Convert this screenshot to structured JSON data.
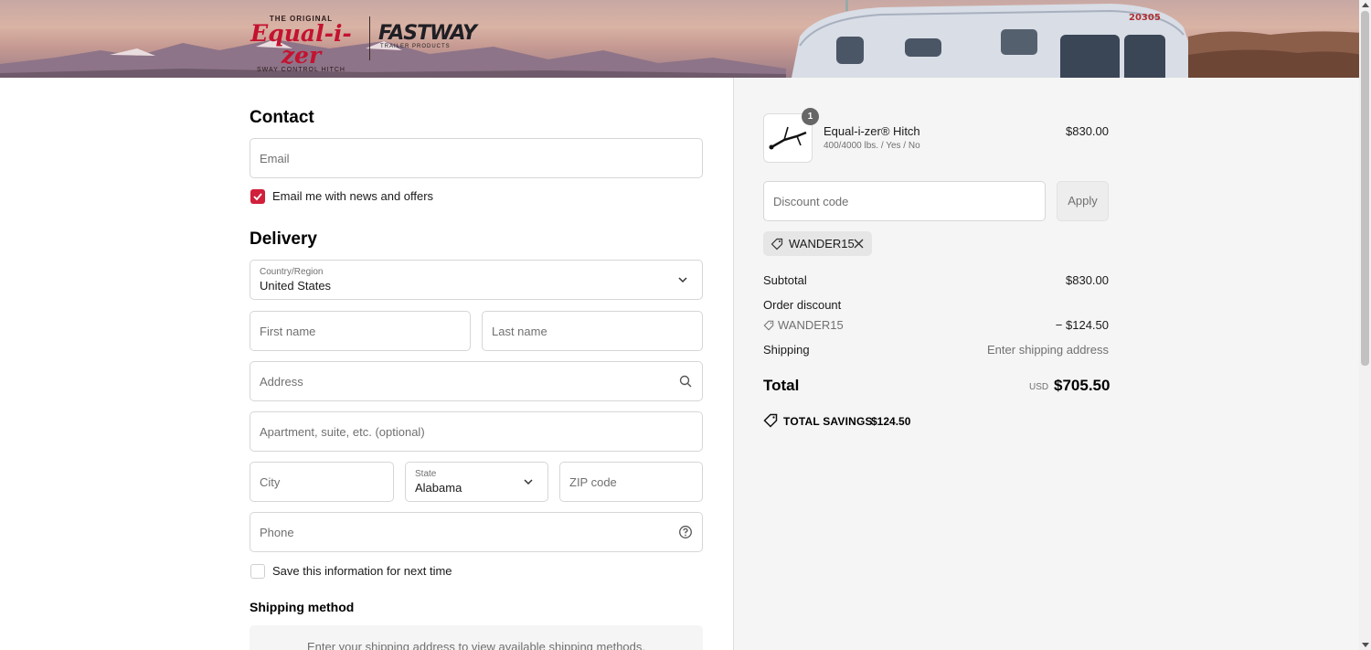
{
  "header": {
    "logo_equalizer_top": "THE ORIGINAL",
    "logo_equalizer_main": "Equal-i-zer",
    "logo_equalizer_bottom": "SWAY CONTROL HITCH",
    "logo_fastway_main": "FASTWAY",
    "logo_fastway_sub": "TRAILER PRODUCTS",
    "trailer_number": "20305"
  },
  "contact": {
    "heading": "Contact",
    "email_placeholder": "Email",
    "newsletter_label": "Email me with news and offers",
    "newsletter_checked": true
  },
  "delivery": {
    "heading": "Delivery",
    "country_label": "Country/Region",
    "country_value": "United States",
    "first_name_placeholder": "First name",
    "last_name_placeholder": "Last name",
    "address_placeholder": "Address",
    "apartment_placeholder": "Apartment, suite, etc. (optional)",
    "city_placeholder": "City",
    "state_label": "State",
    "state_value": "Alabama",
    "zip_placeholder": "ZIP code",
    "phone_placeholder": "Phone",
    "save_info_label": "Save this information for next time",
    "save_info_checked": false
  },
  "shipping_method": {
    "heading": "Shipping method",
    "message": "Enter your shipping address to view available shipping methods."
  },
  "summary": {
    "product": {
      "name": "Equal-i-zer® Hitch",
      "variant": "400/4000 lbs. / Yes / No",
      "price": "$830.00",
      "quantity": "1"
    },
    "discount_placeholder": "Discount code",
    "apply_label": "Apply",
    "applied_code": "WANDER15",
    "subtotal_label": "Subtotal",
    "subtotal_value": "$830.00",
    "order_discount_label": "Order discount",
    "order_discount_code": "WANDER15",
    "order_discount_value": "− $124.50",
    "shipping_label": "Shipping",
    "shipping_value": "Enter shipping address",
    "total_label": "Total",
    "total_currency": "USD",
    "total_value": "$705.50",
    "savings_label": "TOTAL SAVINGS",
    "savings_value": "$124.50"
  },
  "colors": {
    "accent": "#d11f3c",
    "summary_bg": "#f5f5f5",
    "border": "#d6d6d6"
  }
}
